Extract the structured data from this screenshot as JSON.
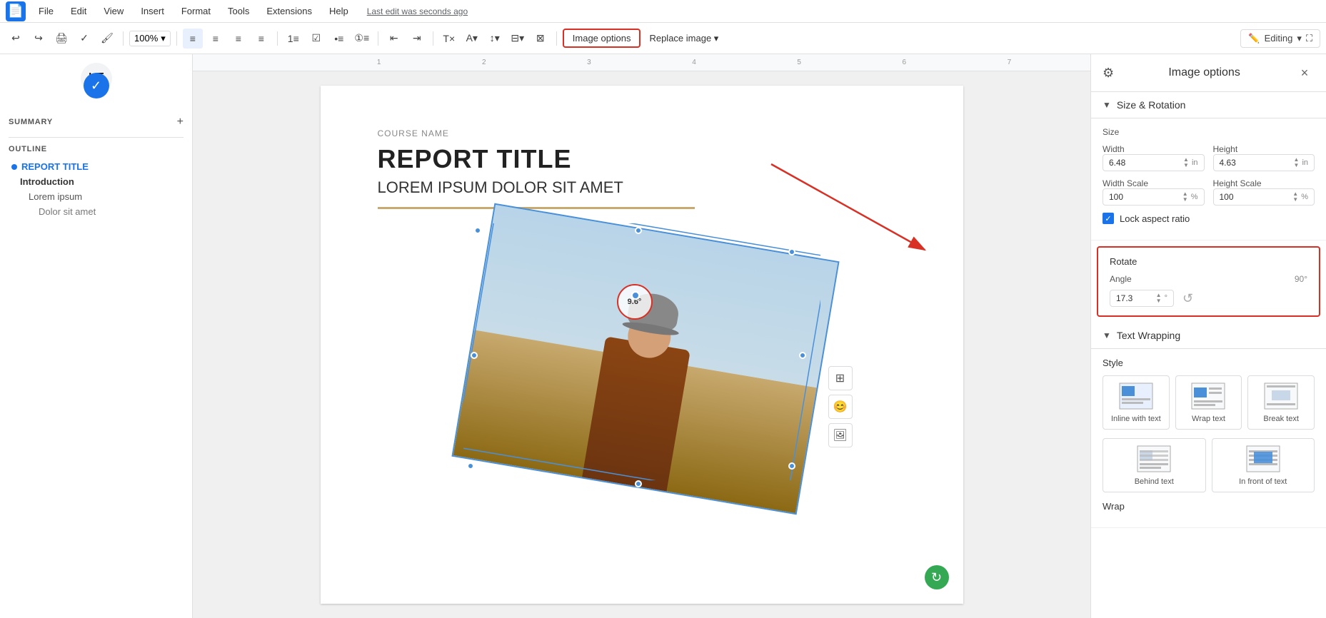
{
  "app": {
    "logo": "D",
    "last_edit": "Last edit was seconds ago"
  },
  "menu": {
    "file": "File",
    "edit": "Edit",
    "view": "View",
    "insert": "Insert",
    "format": "Format",
    "tools": "Tools",
    "extensions": "Extensions",
    "help": "Help"
  },
  "toolbar": {
    "zoom": "100%",
    "image_options_label": "Image options",
    "replace_image_label": "Replace image ▾",
    "editing_label": "Editing",
    "undo": "↩",
    "redo": "↪",
    "print": "🖨",
    "spellcheck": "✓",
    "paintformat": "🖌"
  },
  "sidebar": {
    "back_label": "Back",
    "summary_label": "SUMMARY",
    "add_label": "+",
    "outline_label": "OUTLINE",
    "items": [
      {
        "label": "REPORT TITLE",
        "level": "1"
      },
      {
        "label": "Introduction",
        "level": "2"
      },
      {
        "label": "Lorem ipsum",
        "level": "3"
      },
      {
        "label": "Dolor sit amet",
        "level": "4"
      }
    ]
  },
  "document": {
    "course_name": "COURSE NAME",
    "report_title": "REPORT TITLE",
    "subtitle": "LOREM IPSUM DOLOR SIT AMET",
    "rotation_angle": "9.6°"
  },
  "image_options_panel": {
    "title": "Image options",
    "close_label": "×",
    "size_rotation_section": "Size & Rotation",
    "size_label": "Size",
    "width_label": "Width",
    "height_label": "Height",
    "width_value": "6.48",
    "height_value": "4.63",
    "width_unit": "in",
    "height_unit": "in",
    "width_scale_label": "Width Scale",
    "height_scale_label": "Height Scale",
    "width_scale_value": "100",
    "height_scale_value": "100",
    "width_scale_unit": "%",
    "height_scale_unit": "%",
    "lock_aspect_label": "Lock aspect ratio",
    "rotate_section": "Rotate",
    "angle_label": "Angle",
    "angle_quick_value": "90°",
    "angle_value": "17.3",
    "angle_unit": "°",
    "text_wrapping_section": "Text Wrapping",
    "style_label": "Style",
    "wrap_inline_label": "Inline with text",
    "wrap_wrap_label": "Wrap text",
    "wrap_break_label": "Break text",
    "wrap_behind_label": "Behind text",
    "wrap_infront_label": "In front of text",
    "wrap_section_label": "Wrap"
  },
  "floating_actions": {
    "table_icon": "⊞",
    "emoji_icon": "😊",
    "image_icon": "🖼"
  }
}
